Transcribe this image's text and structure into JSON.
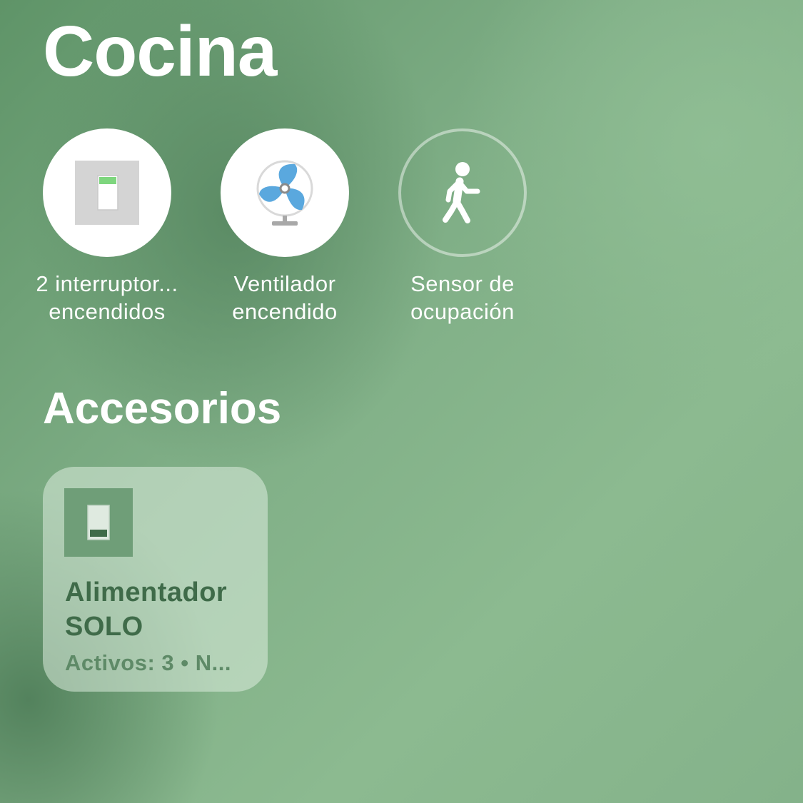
{
  "room": {
    "title": "Cocina"
  },
  "status_items": [
    {
      "label_line1": "2 interruptor...",
      "label_line2": "encendidos",
      "icon": "switch-icon",
      "state": "on"
    },
    {
      "label_line1": "Ventilador",
      "label_line2": "encendido",
      "icon": "fan-icon",
      "state": "on"
    },
    {
      "label_line1": "Sensor de",
      "label_line2": "ocupación",
      "icon": "walking-person-icon",
      "state": "off"
    }
  ],
  "accessories": {
    "section_title": "Accesorios",
    "tiles": [
      {
        "name_line1": "Alimentador",
        "name_line2": "SOLO",
        "status": "Activos: 3 • N...",
        "icon": "switch-icon",
        "state": "off"
      }
    ]
  },
  "colors": {
    "switch_on_indicator": "#7ed67e",
    "fan_blade": "#5aa8de",
    "tile_text": "#3f6b49"
  }
}
